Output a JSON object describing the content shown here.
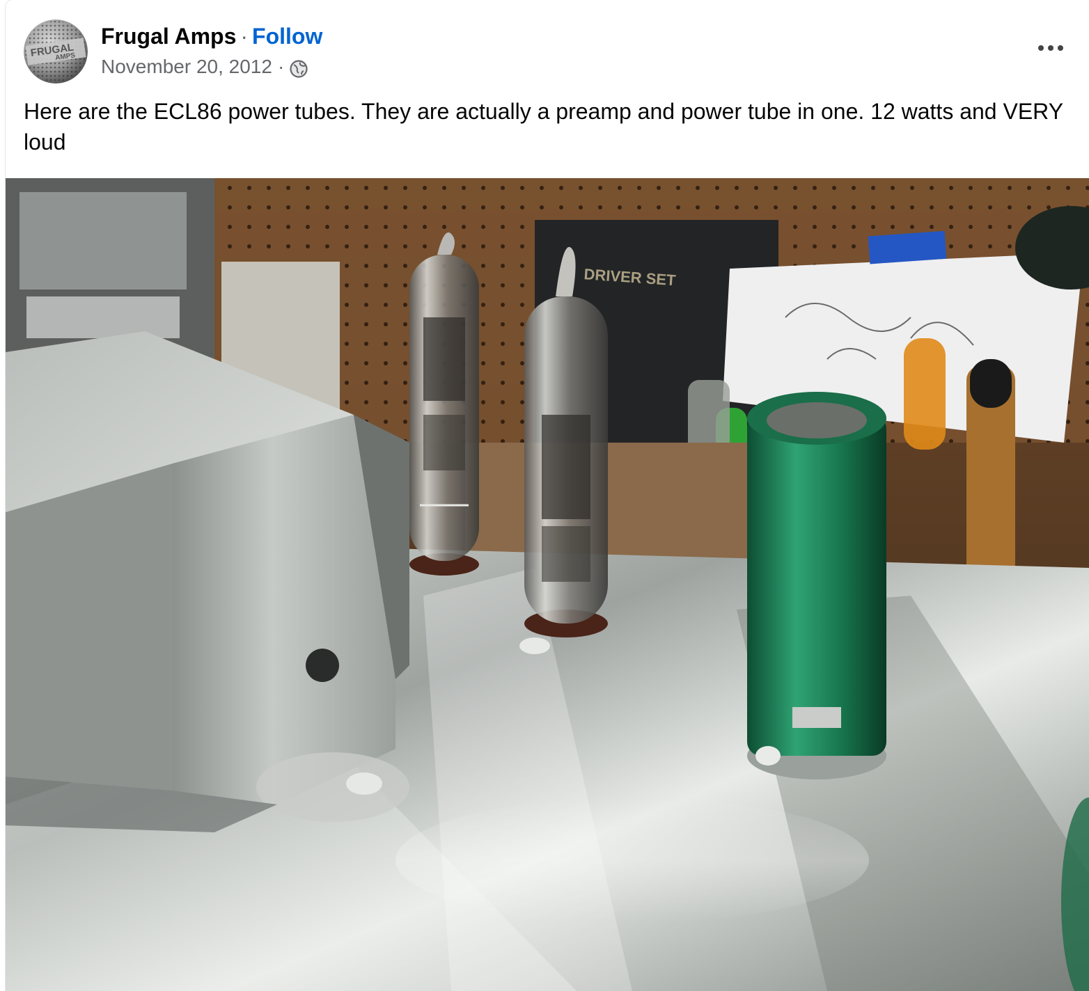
{
  "post": {
    "author": "Frugal Amps",
    "separator": "·",
    "follow_label": "Follow",
    "date": "November 20, 2012",
    "meta_separator": "·",
    "audience_icon": "globe-icon",
    "more_icon": "more-options-icon",
    "text": "Here are the ECL86 power tubes.  They are actually a preamp and power tube in one.  12 watts and VERY loud",
    "avatar_logo": {
      "line1": "FRUGAL",
      "line2": "AMPS"
    },
    "photo": {
      "description_icon": "photo-image",
      "sign_text": "DRIVER SET"
    }
  },
  "colors": {
    "follow": "#0064d1",
    "meta": "#65676b",
    "text": "#050505",
    "capacitor": "#1f8a5a"
  }
}
